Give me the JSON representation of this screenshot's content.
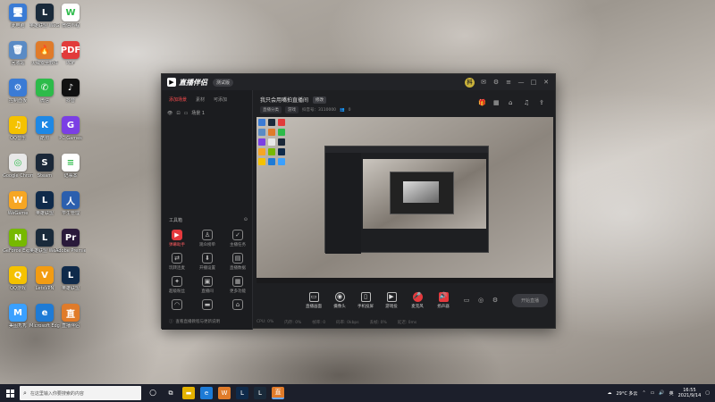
{
  "desktop": {
    "icons": [
      {
        "label": "此电脑",
        "glyph": "🖥",
        "color": "#3a7bd5"
      },
      {
        "label": "英雄联盟 WeGame版",
        "glyph": "L",
        "color": "#1a2a3a"
      },
      {
        "label": "微信小程",
        "glyph": "W",
        "color": "#fff"
      },
      {
        "label": "回收站",
        "glyph": "🗑",
        "color": "#5a8bc5"
      },
      {
        "label": "火绒安全软件",
        "glyph": "🔥",
        "color": "#e07b2a"
      },
      {
        "label": "PDF",
        "glyph": "PDF",
        "color": "#e23b3b"
      },
      {
        "label": "控制面板",
        "glyph": "⚙",
        "color": "#3a7bd5"
      },
      {
        "label": "微信",
        "glyph": "✆",
        "color": "#2dbb4a"
      },
      {
        "label": "抖音",
        "glyph": "♪",
        "color": "#111"
      },
      {
        "label": "QQ音乐",
        "glyph": "♫",
        "color": "#f5c200"
      },
      {
        "label": "酷狗",
        "glyph": "K",
        "color": "#1e88e5"
      },
      {
        "label": "PC Games",
        "glyph": "G",
        "color": "#7b3fe4"
      },
      {
        "label": "Google Chrome",
        "glyph": "◎",
        "color": "#e8e8e8"
      },
      {
        "label": "Steam",
        "glyph": "S",
        "color": "#1b2838"
      },
      {
        "label": "记事本",
        "glyph": "≡",
        "color": "#fff"
      },
      {
        "label": "WeGame",
        "glyph": "W",
        "color": "#f6a623"
      },
      {
        "label": "英雄联盟",
        "glyph": "L",
        "color": "#0f2a4a"
      },
      {
        "label": "学生管理",
        "glyph": "人",
        "color": "#2b5fae"
      },
      {
        "label": "GeForce Experience",
        "glyph": "N",
        "color": "#76b900"
      },
      {
        "label": "英雄联盟 WeGame版",
        "glyph": "L",
        "color": "#1a2a3a"
      },
      {
        "label": "Adobe Premiere",
        "glyph": "Pr",
        "color": "#2a1a3a"
      },
      {
        "label": "QQ游戏",
        "glyph": "Q",
        "color": "#f5c200"
      },
      {
        "label": "LetsVPN",
        "glyph": "V",
        "color": "#f39c12"
      },
      {
        "label": "英雄联盟",
        "glyph": "L",
        "color": "#0f2a4a"
      },
      {
        "label": "美图秀秀",
        "glyph": "M",
        "color": "#3aa0ff"
      },
      {
        "label": "Microsoft Edge",
        "glyph": "e",
        "color": "#1e7bd6"
      },
      {
        "label": "直播伴侣",
        "glyph": "直",
        "color": "#e07b2a"
      }
    ]
  },
  "app": {
    "name": "直播伴侣",
    "version": "测试版",
    "avatar": "抖",
    "left_tabs": [
      "添加场景",
      "素材",
      "可添加"
    ],
    "scene_name": "场景 1",
    "tools_title": "工具箱",
    "tools": [
      {
        "label": "弹幕助手",
        "glyph": "▶",
        "red": true
      },
      {
        "label": "观众榜单",
        "glyph": "♙",
        "red": false
      },
      {
        "label": "主播任务",
        "glyph": "✓",
        "red": false
      },
      {
        "label": "玩转连麦",
        "glyph": "⇄",
        "red": false
      },
      {
        "label": "开播设置",
        "glyph": "⬇",
        "red": false
      },
      {
        "label": "直播数据",
        "glyph": "▤",
        "red": false
      },
      {
        "label": "超级粉丝",
        "glyph": "✦",
        "red": false
      },
      {
        "label": "直播间",
        "glyph": "▣",
        "red": false
      },
      {
        "label": "更多功能",
        "glyph": "▦",
        "red": false
      },
      {
        "label": "",
        "glyph": "◠",
        "red": false
      },
      {
        "label": "",
        "glyph": "▬",
        "red": false
      },
      {
        "label": "",
        "glyph": "⌂",
        "red": false
      }
    ],
    "left_footer": "查看直播教程与更新说明",
    "room_title": "我只会用嘴拍直播间",
    "room_title_tag": "修改",
    "room_chips": [
      "直播分类",
      "游戏"
    ],
    "room_id": "抖音号：3110000",
    "viewer_count": "0",
    "bottom_buttons": [
      {
        "label": "直播画面",
        "glyph": "▭"
      },
      {
        "label": "摄像头",
        "glyph": "◉"
      },
      {
        "label": "手机投屏",
        "glyph": "▯"
      },
      {
        "label": "游戏投",
        "glyph": "▶"
      },
      {
        "label": "麦克风",
        "glyph": "🎤"
      },
      {
        "label": "扬声器",
        "glyph": "🔊"
      }
    ],
    "start_label": "开始直播",
    "status_items": [
      "CPU: 0%",
      "内存: 0%",
      "帧率: 0",
      "码率: 0kbps",
      "丢帧: 0%",
      "延迟: 0ms"
    ]
  },
  "taskbar": {
    "search_placeholder": "在这里输入你要搜索的内容",
    "weather": "29°C 多云",
    "time": "16:55",
    "date": "2021/9/14"
  }
}
